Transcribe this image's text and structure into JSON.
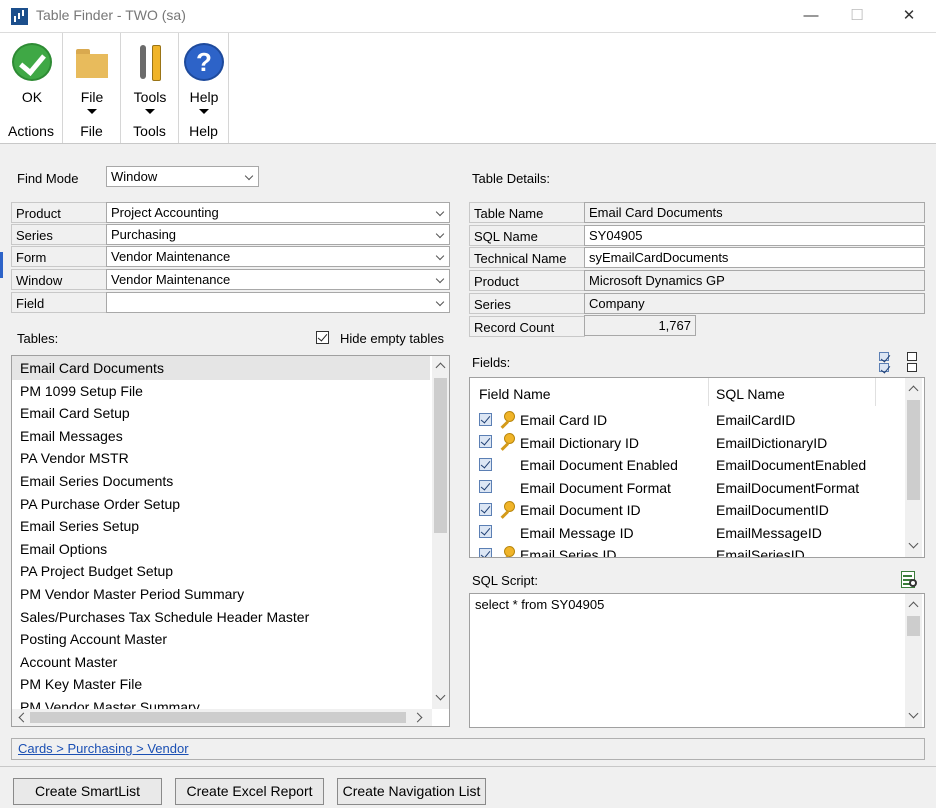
{
  "window": {
    "title": "Table Finder  -  TWO (sa)",
    "minimize": "—",
    "maximize": "☐",
    "close": "✕"
  },
  "ribbon": {
    "groups": [
      {
        "button": "OK",
        "group": "Actions"
      },
      {
        "button": "File",
        "group": "File"
      },
      {
        "button": "Tools",
        "group": "Tools"
      },
      {
        "button": "Help",
        "group": "Help"
      }
    ]
  },
  "form": {
    "find_mode_label": "Find Mode",
    "find_mode_value": "Window",
    "product_label": "Product",
    "product_value": "Project Accounting",
    "series_label": "Series",
    "series_value": "Purchasing",
    "form_label": "Form",
    "form_value": "Vendor Maintenance",
    "window_label": "Window",
    "window_value": "Vendor Maintenance",
    "field_label": "Field",
    "field_value": ""
  },
  "tables": {
    "label": "Tables:",
    "hide_empty_label": "Hide empty tables",
    "items": [
      "Email Card Documents",
      "PM 1099 Setup File",
      "Email Card Setup",
      "Email Messages",
      "PA Vendor MSTR",
      "Email Series Documents",
      "PA Purchase Order Setup",
      "Email Series Setup",
      "Email Options",
      "PA Project Budget Setup",
      "PM Vendor Master Period Summary",
      "Sales/Purchases Tax Schedule Header Master",
      "Posting Account Master",
      "Account Master",
      "PM Key Master File",
      "PM Vendor Master Summary"
    ]
  },
  "details": {
    "label": "Table Details:",
    "table_name_label": "Table Name",
    "table_name": "Email Card Documents",
    "sql_name_label": "SQL Name",
    "sql_name": "SY04905",
    "technical_name_label": "Technical Name",
    "technical_name": "syEmailCardDocuments",
    "product_label": "Product",
    "product": "Microsoft Dynamics GP",
    "series_label": "Series",
    "series": "Company",
    "record_count_label": "Record Count",
    "record_count": "1,767"
  },
  "fields": {
    "label": "Fields:",
    "col_field_name": "Field Name",
    "col_sql_name": "SQL Name",
    "rows": [
      {
        "name": "Email Card ID",
        "sql": "EmailCardID",
        "key": true
      },
      {
        "name": "Email Dictionary ID",
        "sql": "EmailDictionaryID",
        "key": true
      },
      {
        "name": "Email Document Enabled",
        "sql": "EmailDocumentEnabled",
        "key": false
      },
      {
        "name": "Email Document Format",
        "sql": "EmailDocumentFormat",
        "key": false
      },
      {
        "name": "Email Document ID",
        "sql": "EmailDocumentID",
        "key": true
      },
      {
        "name": "Email Message ID",
        "sql": "EmailMessageID",
        "key": false
      },
      {
        "name": "Email Series ID",
        "sql": "EmailSeriesID",
        "key": true
      }
    ]
  },
  "sql_script": {
    "label": "SQL Script:",
    "text": "select * from SY04905"
  },
  "breadcrumb": "Cards > Purchasing > Vendor",
  "buttons": {
    "create_smartlist": "Create SmartList",
    "create_excel_report": "Create Excel Report",
    "create_navigation_list": "Create Navigation List"
  }
}
